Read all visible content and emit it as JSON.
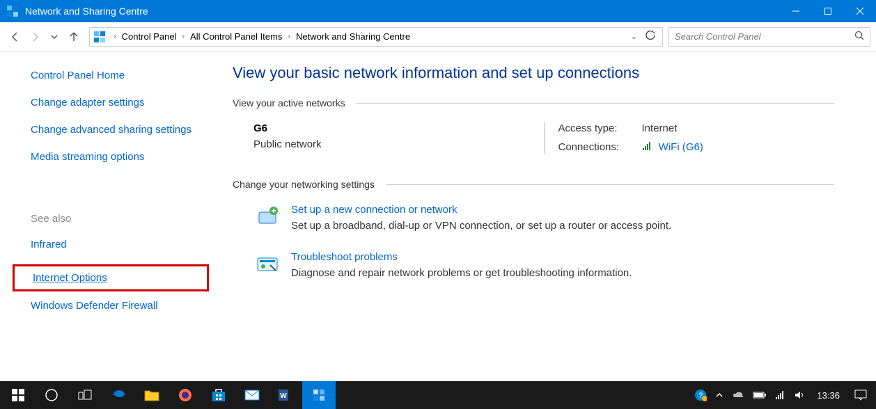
{
  "window": {
    "title": "Network and Sharing Centre"
  },
  "nav": {
    "breadcrumb": [
      "Control Panel",
      "All Control Panel Items",
      "Network and Sharing Centre"
    ],
    "search_placeholder": "Search Control Panel"
  },
  "sidebar": {
    "links": [
      "Control Panel Home",
      "Change adapter settings",
      "Change advanced sharing settings",
      "Media streaming options"
    ],
    "seealso_label": "See also",
    "seealso_links": [
      "Infrared",
      "Internet Options",
      "Windows Defender Firewall"
    ],
    "highlight_index": 1
  },
  "main": {
    "heading": "View your basic network information and set up connections",
    "active_networks_label": "View your active networks",
    "network": {
      "name": "G6",
      "category": "Public network",
      "access_type_label": "Access type:",
      "access_type_value": "Internet",
      "connections_label": "Connections:",
      "connection_name": "WiFi (G6)"
    },
    "change_settings_label": "Change your networking settings",
    "settings": [
      {
        "title": "Set up a new connection or network",
        "desc": "Set up a broadband, dial-up or VPN connection, or set up a router or access point."
      },
      {
        "title": "Troubleshoot problems",
        "desc": "Diagnose and repair network problems or get troubleshooting information."
      }
    ]
  },
  "taskbar": {
    "time": "13:36"
  }
}
